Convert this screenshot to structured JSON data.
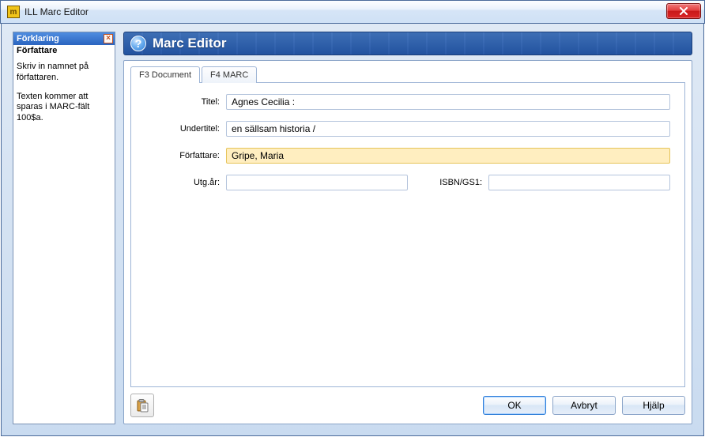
{
  "window": {
    "title": "ILL Marc Editor",
    "app_icon_glyph": "m"
  },
  "sidebar": {
    "header": "Förklaring",
    "close_glyph": "×",
    "topic": "Författare",
    "paragraphs": [
      "Skriv in namnet på författaren.",
      "Texten kommer att sparas i MARC-fält 100$a."
    ]
  },
  "panel": {
    "title": "Marc Editor",
    "help_glyph": "?"
  },
  "tabs": [
    {
      "label": "F3 Document",
      "active": true
    },
    {
      "label": "F4 MARC",
      "active": false
    }
  ],
  "form": {
    "title": {
      "label": "Titel:",
      "value": "Agnes Cecilia :"
    },
    "subtitle": {
      "label": "Undertitel:",
      "value": "en sällsam historia /"
    },
    "author": {
      "label": "Författare:",
      "value": "Gripe, Maria",
      "focused": true
    },
    "year": {
      "label": "Utg.år:",
      "value": ""
    },
    "isbn": {
      "label": "ISBN/GS1:",
      "value": ""
    }
  },
  "buttons": {
    "ok": "OK",
    "cancel": "Avbryt",
    "help": "Hjälp"
  }
}
